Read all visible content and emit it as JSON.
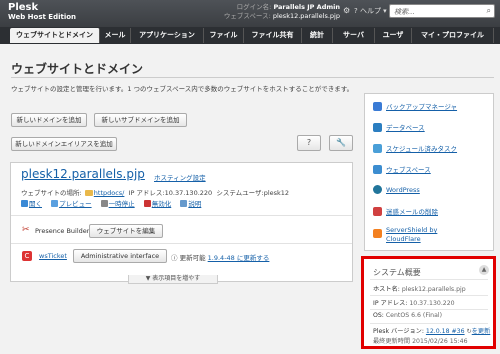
{
  "header": {
    "product": "Plesk",
    "edition": "Web Host Edition",
    "login_label": "ログイン名:",
    "login_value": "Parallels JP Admin",
    "webspace_label": "ウェブスペース:",
    "webspace_value": "plesk12.parallels.pjp",
    "help_label": "ヘルプ",
    "search_placeholder": "検索..."
  },
  "nav": {
    "tabs": [
      {
        "label": "ウェブサイトとドメイン",
        "active": true
      },
      {
        "label": "メール"
      },
      {
        "label": "アプリケーション"
      },
      {
        "label": "ファイル"
      },
      {
        "label": "ファイル共有"
      },
      {
        "label": "統計"
      },
      {
        "label": "サーバ"
      },
      {
        "label": "ユーザ"
      },
      {
        "label": "マイ・プロファイル"
      }
    ]
  },
  "page": {
    "title": "ウェブサイトとドメイン",
    "description": "ウェブサイトの設定と管理を行います。1 つのウェブスペース内で多数のウェブサイトをホストすることができます。",
    "buttons": {
      "add_domain": "新しいドメインを追加",
      "add_subdomain": "新しいサブドメインを追加",
      "add_alias": "新しいドメインエイリアスを追加",
      "help_icon": "?",
      "tools_icon": "🔧"
    }
  },
  "domain": {
    "name": "plesk12.parallels.pjp",
    "hosting_settings": "ホスティング設定",
    "location_label": "ウェブサイトの場所:",
    "location_value": "httpdocs/",
    "ip_label": "IP アドレス:",
    "ip_value": "10.37.130.220",
    "user_label": "システムユーザ:",
    "user_value": "plesk12",
    "actions": [
      {
        "label": "開く",
        "color": "#3a8ad6"
      },
      {
        "label": "プレビュー",
        "color": "#5aa0e0"
      },
      {
        "label": "一時停止",
        "color": "#888888"
      },
      {
        "label": "無効化",
        "color": "#cc3333"
      },
      {
        "label": "説明",
        "color": "#6699cc"
      }
    ],
    "presence_builder_label": "Presence Builder",
    "edit_website_button": "ウェブサイトを編集",
    "wsticket_label": "wsTicket",
    "admin_interface_button": "Administrative interface",
    "update_label": "更新可能",
    "update_link": "1.9.4-48 に更新する",
    "show_more": "▼ 表示項目を増やす"
  },
  "sidebar": {
    "items": [
      {
        "label": "バックアップマネージャ",
        "color": "#3a7bd5"
      },
      {
        "label": "データベース",
        "color": "#2b7ec1"
      },
      {
        "label": "スケジュール済みタスク",
        "color": "#4a9fd8"
      },
      {
        "label": "ウェブスペース",
        "color": "#3c8dd0"
      },
      {
        "label": "WordPress",
        "color": "#21759b"
      },
      {
        "label": "迷惑メールの削除",
        "color": "#d04040"
      },
      {
        "label": "ServerShield by",
        "label2": "CloudFlare",
        "color": "#f38020"
      }
    ]
  },
  "system": {
    "title": "システム概要",
    "hostname_label": "ホスト名:",
    "hostname_value": "plesk12.parallels.pjp",
    "ip_label": "IP アドレス:",
    "ip_value": "10.37.130.220",
    "os_label": "OS:",
    "os_value": "CentOS 6.6 (Final)",
    "plesk_label": "Plesk バージョン:",
    "plesk_value": "12.0.18 #36",
    "plesk_update": "を更新",
    "updated_label": "最終更新時間",
    "updated_value": "2015/02/26 15:46"
  }
}
